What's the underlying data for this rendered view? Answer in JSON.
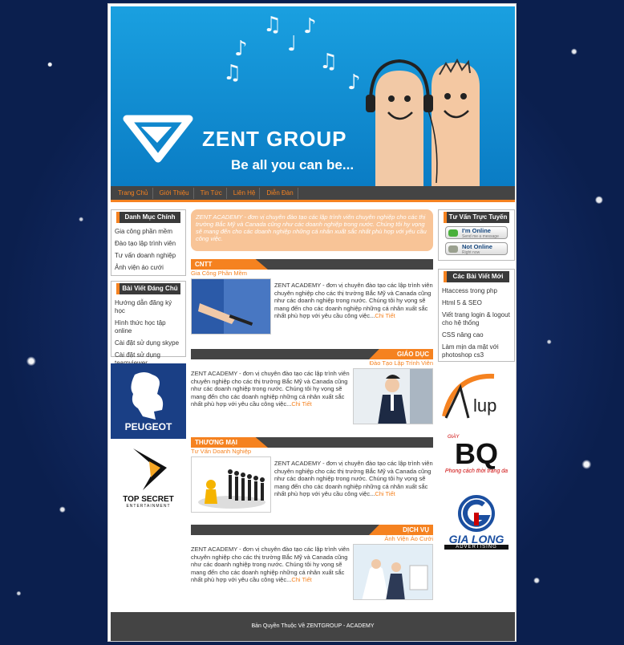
{
  "banner": {
    "brand": "ZENT GROUP",
    "tagline": "Be all you can be..."
  },
  "nav": [
    "Trang Chủ",
    "Giới Thiệu",
    "Tin Tức",
    "Liên Hệ",
    "Diễn Đàn"
  ],
  "left": {
    "menu_title": "Danh Mục Chính",
    "menu_items": [
      "Gia công phần mềm",
      "Đào tạo lập trình viên",
      "Tư vấn doanh nghiệp",
      "Ảnh viện áo cưới"
    ],
    "featured_title": "Bài Viết Đáng Chú Ý",
    "featured_items": [
      "Hướng dẫn đăng ký học",
      "Hình thức học tập online",
      "Cài đặt sử dụng skype",
      "Cài đặt sử dụng teamviewer"
    ],
    "sponsors": [
      "PEUGEOT",
      "TOP SECRET",
      "ENTERTAINMENT"
    ]
  },
  "intro": "ZENT ACADEMY - đơn vị chuyên đào tạo các lập trình viên chuyên nghiệp cho các thị trường Bắc Mỹ và Canada cũng như các doanh nghiệp trong nước. Chúng tôi hy vọng sẽ mang đến cho các doanh nghiệp những cá nhân xuất sắc nhất phù hợp với yêu cầu công việc.",
  "article_text": "ZENT ACADEMY - đơn vị chuyên đào tạo các lập trình viên chuyên nghiệp cho các thị trường Bắc Mỹ và Canada cũng như các doanh nghiệp trong nước. Chúng tôi hy vọng sẽ mang đến cho các doanh nghiệp những cá nhân xuất sắc nhất phù hợp với yêu cầu công việc...",
  "more_label": "Chi Tiết",
  "sections": [
    {
      "title": "CNTT",
      "sub": "Gia Công Phần Mềm"
    },
    {
      "title": "GIÁO DỤC",
      "sub": "Đào Tạo Lập Trình Viên"
    },
    {
      "title": "THƯƠNG MẠI",
      "sub": "Tư Vấn Doanh Nghiệp"
    },
    {
      "title": "DỊCH VỤ",
      "sub": "Ảnh Viện Áo Cưới"
    }
  ],
  "right": {
    "support_title": "Tư Vấn Trực Tuyến",
    "online_label": "I'm Online",
    "online_sub": "Send me a message",
    "offline_label": "Not Online",
    "offline_sub": "Right now",
    "recent_title": "Các Bài Viết Mới",
    "recent_items": [
      "Htaccess trong php",
      "Html 5 & SEO",
      "Viết trang login & logout cho hệ thống",
      "CSS nâng cao",
      "Làm mịn da mặt với photoshop cs3"
    ],
    "logos": {
      "alup": "lup",
      "bq_small": "GIÀY",
      "bq": "BQ",
      "bq_slogan": "Phong cách thời trang da",
      "gialong": "GIA LONG",
      "gialong_sub": "ADVERTISING"
    }
  },
  "footer": "Bản Quyền Thuộc Về ZENTGROUP - ACADEMY",
  "colors": {
    "accent": "#f58220",
    "dark": "#444444",
    "banner": "#1aa0e0"
  }
}
